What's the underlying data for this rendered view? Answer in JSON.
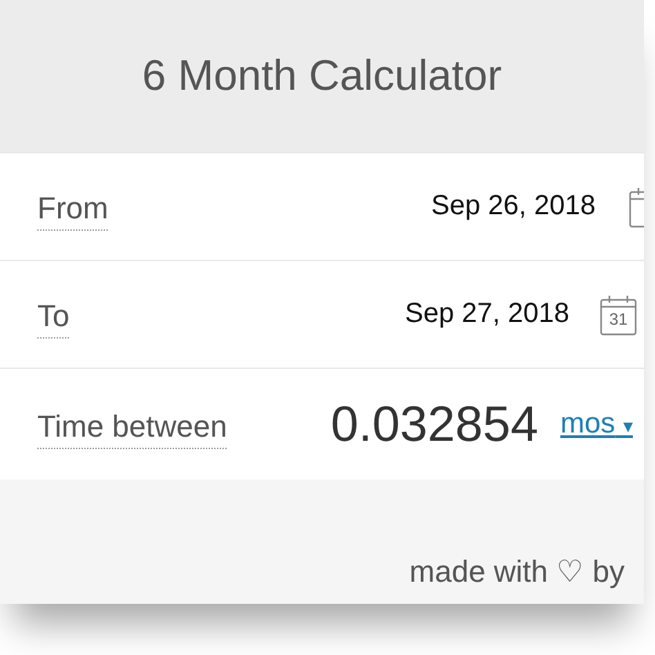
{
  "title": "6 Month Calculator",
  "rows": [
    {
      "kind": "date",
      "label": "From",
      "value": "Sep 26, 2018",
      "calendar": {
        "clipped": true
      }
    },
    {
      "kind": "date",
      "label": "To",
      "value": "Sep 27, 2018",
      "calendar": {
        "clipped": false,
        "day": "31"
      }
    },
    {
      "kind": "result",
      "label": "Time between",
      "value": "0.032854",
      "unit": "mos",
      "caret": "▾"
    }
  ],
  "footer": "made with ♡ by"
}
